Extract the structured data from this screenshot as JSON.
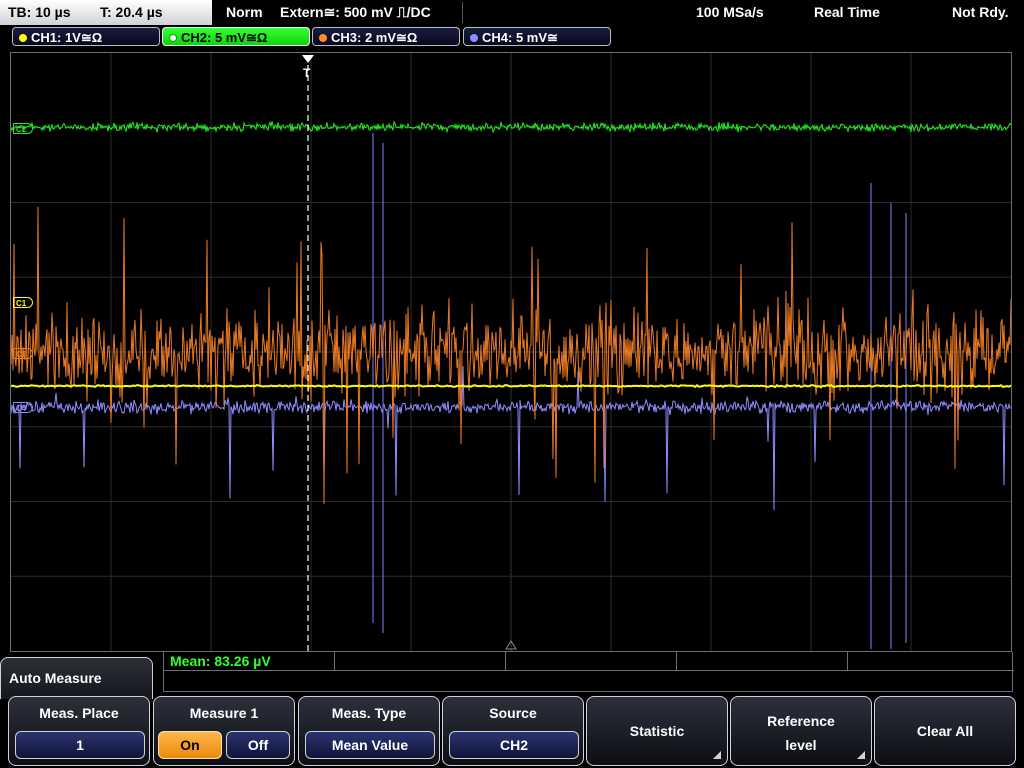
{
  "status_bar": {
    "timebase": "TB: 10 µs",
    "trigger_time": "T: 20.4 µs",
    "mode": "Norm",
    "trigger_source": "Extern≅: 500 mV ⎍/DC",
    "sample_rate": "100 MSa/s",
    "acq_mode": "Real Time",
    "trigger_status": "Not Rdy."
  },
  "channels": [
    {
      "label": "CH1: 1V≅Ω",
      "color": "#ffff00",
      "active": false
    },
    {
      "label": "CH2: 5 mV≅Ω",
      "color": "#22ee22",
      "active": true
    },
    {
      "label": "CH3: 2 mV≅Ω",
      "color": "#ff8a2a",
      "active": false
    },
    {
      "label": "CH4: 5 mV≅",
      "color": "#8f8cff",
      "active": false
    }
  ],
  "markers": {
    "ch1": "C1",
    "ch2": "C2",
    "ch3": "C3",
    "ch4": "C4",
    "trigger": "T"
  },
  "measurement": {
    "result": "Mean: 83.26 µV"
  },
  "menu": {
    "title": "Auto Measure",
    "meas_place_label": "Meas. Place",
    "meas_place_value": "1",
    "measure1_label": "Measure 1",
    "measure1_on": "On",
    "measure1_off": "Off",
    "meas_type_label": "Meas. Type",
    "meas_type_value": "Mean Value",
    "source_label": "Source",
    "source_value": "CH2",
    "statistic_label": "Statistic",
    "reference_level_label_1": "Reference",
    "reference_level_label_2": "level",
    "clear_all_label": "Clear All"
  },
  "colors": {
    "ch1": "#ffff00",
    "ch2": "#22ee22",
    "ch3": "#e87a24",
    "ch4": "#8f8cff",
    "active_toggle": "#f5a22a"
  }
}
